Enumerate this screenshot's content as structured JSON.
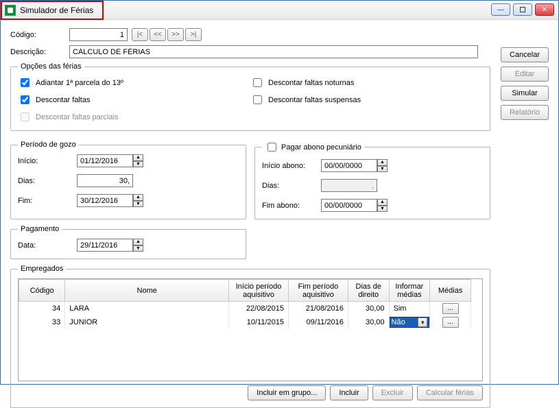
{
  "window": {
    "title": "Simulador de Férias"
  },
  "labels": {
    "codigo": "Código:",
    "descricao": "Descrição:",
    "opcoes_legend": "Opções das férias",
    "periodo_legend": "Período de gozo",
    "inicio": "Início:",
    "dias": "Dias:",
    "fim": "Fim:",
    "abono_legend": "Pagar abono pecuniário",
    "inicio_abono": "Início abono:",
    "fim_abono": "Fim abono:",
    "pagamento_legend": "Pagamento",
    "data": "Data:",
    "empregados_legend": "Empregados"
  },
  "fields": {
    "codigo": "1",
    "descricao": "CÁLCULO DE FÉRIAS",
    "inicio": "01/12/2016",
    "dias": "30,",
    "fim": "30/12/2016",
    "inicio_abono": "00/00/0000",
    "dias_abono": ",",
    "fim_abono": "00/00/0000",
    "pagamento_data": "29/11/2016"
  },
  "nav": {
    "first": "|<",
    "prev": "<<",
    "next": ">>",
    "last": ">|"
  },
  "opts": {
    "adiantar": "Adiantar 1ª parcela do 13º",
    "descontar_faltas": "Descontar faltas",
    "descontar_parciais": "Descontar faltas parciais",
    "descontar_noturnas": "Descontar faltas noturnas",
    "descontar_suspensas": "Descontar faltas suspensas"
  },
  "side_buttons": {
    "cancelar": "Cancelar",
    "editar": "Editar",
    "simular": "Simular",
    "relatorio": "Relatório"
  },
  "table": {
    "headers": {
      "codigo": "Código",
      "nome": "Nome",
      "ini": "Início período aquisitivo",
      "fim": "Fim período aquisitivo",
      "dias": "Dias de direito",
      "informar": "Informar médias",
      "medias": "Médias"
    },
    "rows": [
      {
        "codigo": "34",
        "nome": "LARA",
        "ini": "22/08/2015",
        "fim": "21/08/2016",
        "dias": "30,00",
        "informar": "Sim"
      },
      {
        "codigo": "33",
        "nome": "JUNIOR",
        "ini": "10/11/2015",
        "fim": "09/11/2016",
        "dias": "30,00",
        "informar": "Não"
      }
    ]
  },
  "bottom_buttons": {
    "grupo": "Incluir em grupo...",
    "incluir": "Incluir",
    "excluir": "Excluir",
    "calcular": "Calcular férias"
  }
}
